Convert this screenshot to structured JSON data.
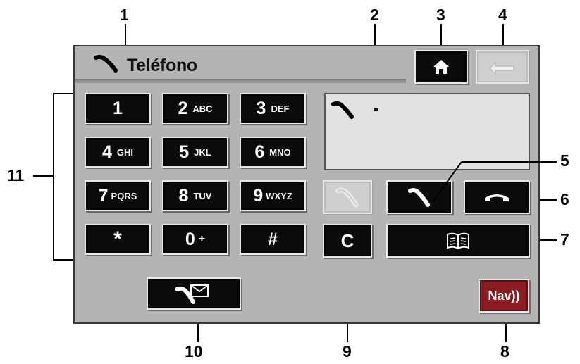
{
  "title": "Teléfono",
  "keypad": [
    {
      "digit": "1",
      "letters": ""
    },
    {
      "digit": "2",
      "letters": "ABC"
    },
    {
      "digit": "3",
      "letters": "DEF"
    },
    {
      "digit": "4",
      "letters": "GHI"
    },
    {
      "digit": "5",
      "letters": "JKL"
    },
    {
      "digit": "6",
      "letters": "MNO"
    },
    {
      "digit": "7",
      "letters": "PQRS"
    },
    {
      "digit": "8",
      "letters": "TUV"
    },
    {
      "digit": "9",
      "letters": "WXYZ"
    },
    {
      "digit": "*",
      "letters": ""
    },
    {
      "digit": "0",
      "letters": "+"
    },
    {
      "digit": "#",
      "letters": ""
    }
  ],
  "clear_label": "C",
  "nav_label": "Nav))",
  "callouts": [
    "1",
    "2",
    "3",
    "4",
    "5",
    "6",
    "7",
    "8",
    "9",
    "10",
    "11"
  ],
  "icons": {
    "title": "phone-handset-icon",
    "home": "home-icon",
    "back": "back-arrow-icon",
    "display": "phone-handset-icon",
    "redial": "phone-handset-icon",
    "call": "phone-handset-icon",
    "hangup": "phone-hangup-icon",
    "phonebook": "phonebook-icon",
    "messages": "phone-message-icon"
  },
  "colors": {
    "screen_bg": "#b4b4b4",
    "button_bg": "#0b0b0b",
    "button_text": "#ffffff",
    "display_bg": "#e2e2e2",
    "disabled_button_bg": "#cfcfcf",
    "nav_button_bg": "#8a1c22"
  }
}
